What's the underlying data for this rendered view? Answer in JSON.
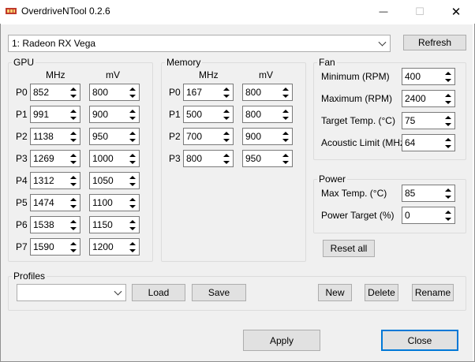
{
  "window": {
    "title": "OverdriveNTool 0.2.6",
    "controls": {
      "minimize": "—",
      "maximize": "☐",
      "close": "✕"
    }
  },
  "device": {
    "selected": "1: Radeon RX Vega"
  },
  "buttons": {
    "refresh": "Refresh",
    "reset_all": "Reset all",
    "apply": "Apply",
    "close": "Close"
  },
  "gpu": {
    "title": "GPU",
    "col_mhz": "MHz",
    "col_mv": "mV",
    "states": [
      {
        "label": "P0",
        "mhz": "852",
        "mv": "800"
      },
      {
        "label": "P1",
        "mhz": "991",
        "mv": "900"
      },
      {
        "label": "P2",
        "mhz": "1138",
        "mv": "950"
      },
      {
        "label": "P3",
        "mhz": "1269",
        "mv": "1000"
      },
      {
        "label": "P4",
        "mhz": "1312",
        "mv": "1050"
      },
      {
        "label": "P5",
        "mhz": "1474",
        "mv": "1100"
      },
      {
        "label": "P6",
        "mhz": "1538",
        "mv": "1150"
      },
      {
        "label": "P7",
        "mhz": "1590",
        "mv": "1200"
      }
    ]
  },
  "memory": {
    "title": "Memory",
    "col_mhz": "MHz",
    "col_mv": "mV",
    "states": [
      {
        "label": "P0",
        "mhz": "167",
        "mv": "800"
      },
      {
        "label": "P1",
        "mhz": "500",
        "mv": "800"
      },
      {
        "label": "P2",
        "mhz": "700",
        "mv": "900"
      },
      {
        "label": "P3",
        "mhz": "800",
        "mv": "950"
      }
    ]
  },
  "fan": {
    "title": "Fan",
    "rows": [
      {
        "label": "Minimum (RPM)",
        "value": "400"
      },
      {
        "label": "Maximum (RPM)",
        "value": "2400"
      },
      {
        "label": "Target Temp. (°C)",
        "value": "75"
      },
      {
        "label": "Acoustic Limit (MHz)",
        "value": "64"
      }
    ]
  },
  "power": {
    "title": "Power",
    "rows": [
      {
        "label": "Max Temp. (°C)",
        "value": "85"
      },
      {
        "label": "Power Target (%)",
        "value": "0"
      }
    ]
  },
  "profiles": {
    "title": "Profiles",
    "selected": "",
    "load": "Load",
    "save": "Save",
    "new": "New",
    "delete": "Delete",
    "rename": "Rename"
  }
}
